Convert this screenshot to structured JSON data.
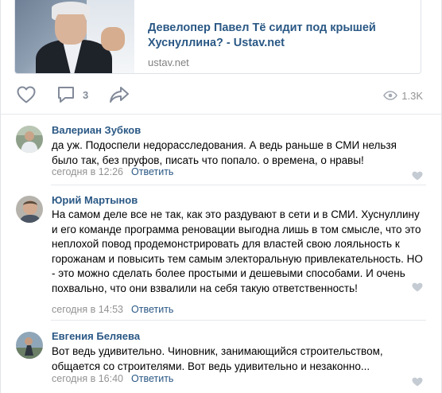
{
  "link": {
    "title": "Девелопер Павел Тё сидит под крышей Хуснуллина? - Ustav.net",
    "domain": "ustav.net"
  },
  "actions": {
    "comment_count": "3",
    "views": "1.3K"
  },
  "comments": [
    {
      "author": "Валериан Зубков",
      "text": "да уж. Подоспели недорасследования. А ведь раньше в СМИ нельзя было так, без пруфов, писать что попало. о времена, о нравы!",
      "time": "сегодня в 12:26",
      "reply": "Ответить"
    },
    {
      "author": "Юрий Мартынов",
      "text": "На самом деле все не так, как это раздувают в сети и в СМИ. Хуснуллину и его команде программа реновации выгодна лишь в том смысле, что это неплохой повод продемонстрировать для властей свою лояльность к горожанам и повысить тем самым электоральную привлекательность. НО - это можно сделать более простыми и дешевыми способами. И очень похвально, что они взвалили на себя такую ответственность!",
      "time": "сегодня в 14:53",
      "reply": "Ответить"
    },
    {
      "author": "Евгения Беляева",
      "text": "Вот ведь удивительно. Чиновник, занимающийся строительством, общается со строителями. Вот ведь удивительно и незаконно...",
      "time": "сегодня в 16:40",
      "reply": "Ответить"
    }
  ],
  "icons": {
    "like": "heart-icon",
    "comment": "comment-bubble-icon",
    "share": "share-arrow-icon",
    "views": "eye-icon"
  },
  "colors": {
    "link": "#2a5885",
    "muted": "#939393",
    "icon": "#828a99"
  }
}
